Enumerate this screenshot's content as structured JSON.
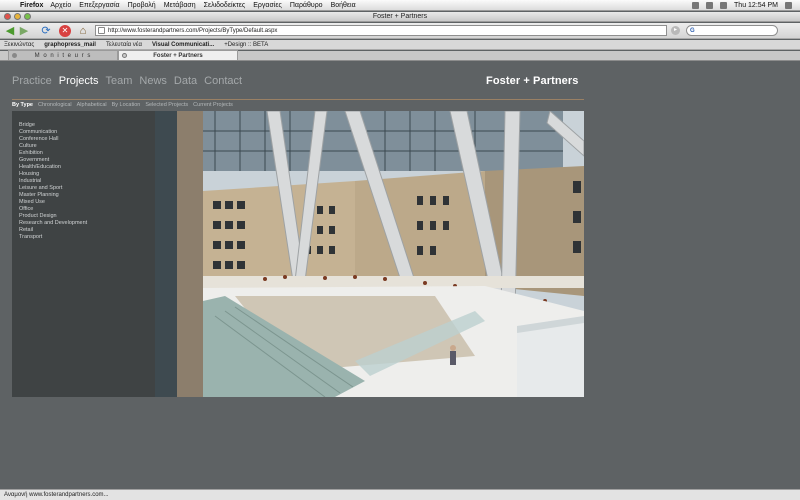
{
  "menubar": {
    "app": "Firefox",
    "items": [
      "Αρχείο",
      "Επεξεργασία",
      "Προβολή",
      "Μετάβαση",
      "Σελιδοδείκτες",
      "Εργασίες",
      "Παράθυρο",
      "Βοήθεια"
    ],
    "clock": "Thu 12:54 PM"
  },
  "window": {
    "title": "Foster + Partners"
  },
  "toolbar": {
    "url": "http://www.fosterandpartners.com/Projects/ByType/Default.aspx"
  },
  "bookmarks": [
    "Ξεκινώντας",
    "graphopress_mail",
    "Τελευταία νέα",
    "Visual Communicati...",
    "+Design :: BETA"
  ],
  "tabs": [
    "M o n i t e u r s",
    "Foster + Partners"
  ],
  "site": {
    "nav": [
      "Practice",
      "Projects",
      "Team",
      "News",
      "Data",
      "Contact"
    ],
    "logo": "Foster + Partners",
    "subnav": [
      "By Type",
      "Chronological",
      "Alphabetical",
      "By Location",
      "Selected Projects",
      "Current Projects"
    ],
    "types": [
      "Bridge",
      "Communication",
      "Conference Hall",
      "Culture",
      "Exhibition",
      "Government",
      "Health/Education",
      "Housing",
      "Industrial",
      "Leisure and Sport",
      "Master Planning",
      "Mixed Use",
      "Office",
      "Product Design",
      "Research and Development",
      "Retail",
      "Transport"
    ]
  },
  "status": {
    "text": "Αναμονή www.fosterandpartners.com..."
  }
}
